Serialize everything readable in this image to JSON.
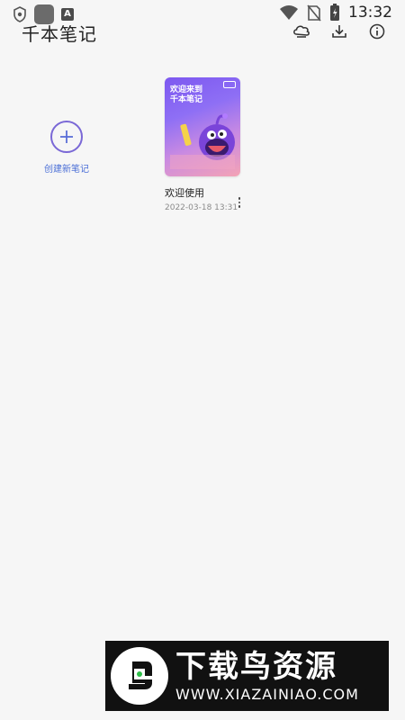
{
  "status_bar": {
    "time": "13:32",
    "icons": [
      "shield-icon",
      "app-square-icon",
      "font-a-icon",
      "wifi-icon",
      "no-sim-icon",
      "battery-charging-icon"
    ]
  },
  "header": {
    "title": "千本笔记",
    "actions": [
      {
        "name": "cloud-sync-icon"
      },
      {
        "name": "download-icon"
      },
      {
        "name": "info-icon"
      }
    ]
  },
  "create": {
    "label": "创建新笔记",
    "icon": "plus-icon"
  },
  "notes": [
    {
      "cover_title": "欢迎来到千本笔记",
      "title": "欢迎使用",
      "date": "2022-03-18 13:31",
      "more_icon": "more-vertical-icon"
    }
  ],
  "watermark": {
    "brand": "下载鸟资源",
    "url": "WWW.XIAZAINIAO.COM"
  },
  "colors": {
    "accent": "#4a6ed6",
    "purple": "#7a68d6"
  }
}
